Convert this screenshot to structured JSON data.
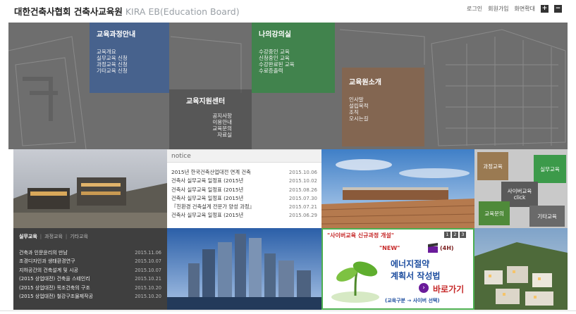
{
  "header": {
    "title_ko": "대한건축사협회 건축사교육원",
    "title_en": "KIRA EB(Education Board)",
    "nav": [
      "로그인",
      "회원가입",
      "화면확대"
    ],
    "zoom_in": "+",
    "zoom_out": "−"
  },
  "hero": {
    "menus": [
      {
        "title": "교육과정안내",
        "items": [
          "교육개요",
          "실무교육 신청",
          "과정교육 신청",
          "기타교육 신청"
        ]
      },
      {
        "title": "나의강의실",
        "items": [
          "수강중인 교육",
          "신청중인 교육",
          "수강완료된 교육",
          "수료증출력"
        ]
      },
      {
        "title": "교육원소개",
        "items": [
          "인사말",
          "설립목적",
          "조직",
          "오시는길"
        ]
      },
      {
        "title": "교육지원센터",
        "items": [
          "공지사항",
          "이용안내",
          "교육문의",
          "자료실"
        ]
      }
    ]
  },
  "notice": {
    "heading": "notice",
    "rows": [
      {
        "title": "2015년 한국건축산업대전 연계 건축",
        "date": "2015.10.06"
      },
      {
        "title": "건축사 실무교육 일정표 (2015년",
        "date": "2015.10.02"
      },
      {
        "title": "건축사 실무교육 일정표 (2015년",
        "date": "2015.08.26"
      },
      {
        "title": "건축사 실무교육 일정표 (2015년",
        "date": "2015.07.30"
      },
      {
        "title": "『친환경 건축설계 전문가 양성 과정』",
        "date": "2015.07.21"
      },
      {
        "title": "건축사 실무교육 일정표 (2015년",
        "date": "2015.06.29"
      }
    ]
  },
  "quick": {
    "course": "과정교육",
    "practical": "실무교육",
    "cyber": "사이버교육",
    "click": "click",
    "inquiry": "교육문의",
    "other": "기타교육"
  },
  "courses": {
    "tabs": [
      "실무교육",
      "과정교육",
      "기타교육"
    ],
    "rows": [
      {
        "title": "건축과 인문윤리의 만남",
        "date": "2015.11.06"
      },
      {
        "title": "조경디자인과 생태환경연구",
        "date": "2015.10.07"
      },
      {
        "title": "지하공간의 건축설계 및 시공",
        "date": "2015.10.07"
      },
      {
        "title": "(2015 상업대전) 건축을 스테인리",
        "date": "2015.10.21"
      },
      {
        "title": "(2015 상업대전) 목조건축의 구조",
        "date": "2015.10.20"
      },
      {
        "title": "(2015 상업대전) 철강구조물제작공",
        "date": "2015.10.20"
      }
    ]
  },
  "banner": {
    "top": "\"사이버교육 신규과정 개설\"",
    "pages": [
      "1",
      "2",
      "3"
    ],
    "new": "\"NEW\"",
    "hours": "(4H)",
    "line1": "에너지절약",
    "line2": "계획서 작성법",
    "go": "바로가기",
    "path": "(교육구분 → 사이버 선택)"
  },
  "colors": {
    "menu_blue": "#3c5f96",
    "menu_green": "#37874a",
    "menu_brown": "#8c6446",
    "banner_border": "#4caf50",
    "banner_red": "#c62828",
    "banner_blue": "#1f4fa0"
  }
}
